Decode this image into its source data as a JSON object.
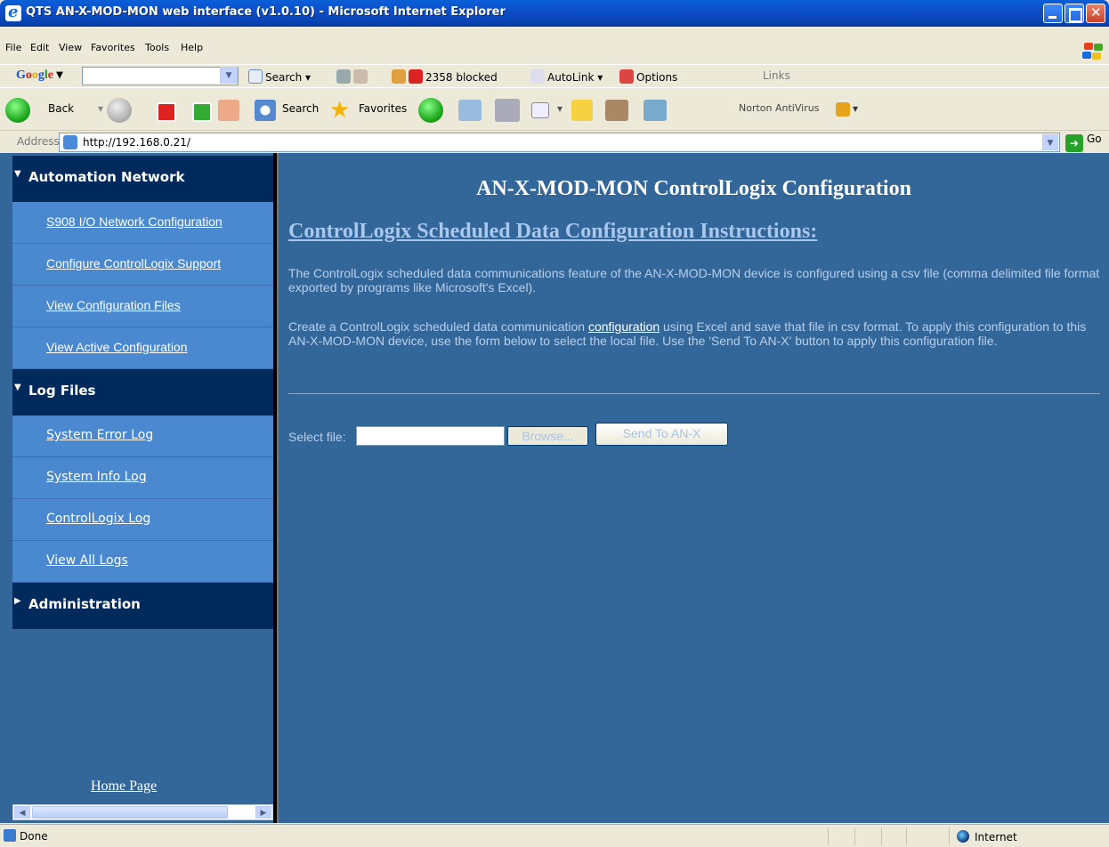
{
  "window": {
    "title": "QTS AN-X-MOD-MON web interface (v1.0.10) - Microsoft Internet Explorer"
  },
  "menu": [
    "File",
    "Edit",
    "View",
    "Favorites",
    "Tools",
    "Help"
  ],
  "google_toolbar": {
    "logo": "Google",
    "search": "Search",
    "blocked": "2358 blocked",
    "autolink": "AutoLink",
    "options": "Options",
    "links": "Links"
  },
  "std_toolbar": {
    "back": "Back",
    "search": "Search",
    "favorites": "Favorites",
    "norton": "Norton AntiVirus"
  },
  "address": {
    "label": "Address",
    "url": "http://192.168.0.21/",
    "go": "Go"
  },
  "nav": {
    "section1": "Automation Network",
    "section1_items": [
      "S908 I/O Network Configuration",
      "Configure ControlLogix Support",
      "View Configuration Files",
      "View Active Configuration"
    ],
    "section2": "Log Files",
    "section2_items": [
      "System Error Log",
      "System Info Log",
      "ControlLogix Log",
      "View All Logs"
    ],
    "section3": "Administration",
    "home": "Home Page"
  },
  "main": {
    "title": "AN-X-MOD-MON ControlLogix Configuration",
    "subtitle": "ControlLogix Scheduled Data Configuration Instructions:",
    "para1": "The ControlLogix scheduled data communications feature of the AN-X-MOD-MON device is configured using a csv file (comma delimited file format exported by programs like Microsoft's Excel).",
    "para2_before": "Create a ControlLogix scheduled data communication ",
    "para2_link": "configuration",
    "para2_after": " using Excel and save that file in csv format. To apply this configuration to this AN-X-MOD-MON device, use the form below to select the local file. Use the 'Send To AN-X' button to apply this configuration file.",
    "select_label": "Select file:",
    "file_value": "",
    "browse_label": "Browse...",
    "send_label": "Send To AN-X"
  },
  "status": {
    "text": "Done",
    "zone": "Internet"
  }
}
